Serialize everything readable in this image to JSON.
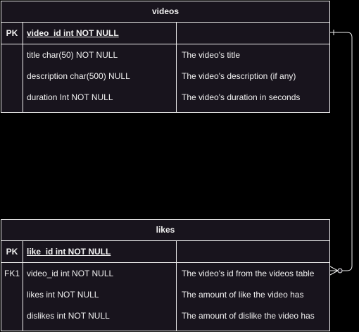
{
  "tables": [
    {
      "title": "videos",
      "pk": {
        "key": "PK",
        "attr": "video_id int NOT NULL",
        "desc": ""
      },
      "rows": [
        {
          "key": "",
          "attr": "title char(50) NOT NULL",
          "desc": "The video's title"
        },
        {
          "key": "",
          "attr": "description char(500) NULL",
          "desc": "The video's description (if any)"
        },
        {
          "key": "",
          "attr": "duration Int NOT NULL",
          "desc": "The video's duration in seconds"
        }
      ]
    },
    {
      "title": "likes",
      "pk": {
        "key": "PK",
        "attr": "like_id int NOT NULL",
        "desc": ""
      },
      "rows": [
        {
          "key": "FK1",
          "attr": "video_id int NOT NULL",
          "desc": "The video's id from the videos table"
        },
        {
          "key": "",
          "attr": "likes int NOT NULL",
          "desc": "The amount of like the video has"
        },
        {
          "key": "",
          "attr": "dislikes int NOT NULL",
          "desc": "The amount of dislike the video has"
        }
      ]
    }
  ],
  "relationship": {
    "from": "videos.video_id",
    "to": "likes.video_id",
    "from_end": "one",
    "to_end": "zero-or-many"
  },
  "colors": {
    "background": "#000000",
    "table_fill": "#18141d",
    "stroke": "#f0f0f0",
    "text": "#f0f0f0"
  }
}
